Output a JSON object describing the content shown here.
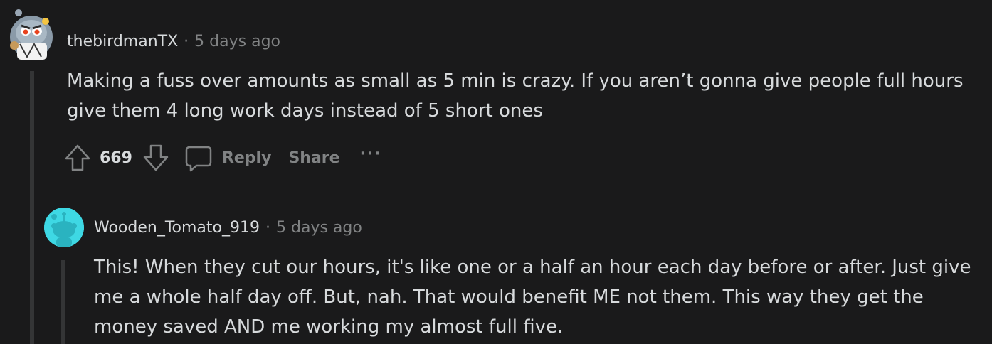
{
  "comments": [
    {
      "username": "thebirdmanTX",
      "separator": "·",
      "time": "5 days ago",
      "avatar_icon": "snoo-avatar-icon",
      "body_lines": [
        "Making a fuss over amounts as small as 5 min is crazy. If you aren’t gonna give people full hours",
        "give them 4 long work days instead of 5 short ones"
      ],
      "actions": {
        "upvote_icon": "upvote-arrow-icon",
        "votes": "669",
        "downvote_icon": "downvote-arrow-icon",
        "reply_icon": "comment-bubble-icon",
        "reply_label": "Reply",
        "share_label": "Share",
        "more_label": "···"
      }
    },
    {
      "username": "Wooden_Tomato_919",
      "separator": "·",
      "time": "5 days ago",
      "avatar_icon": "default-snoo-avatar-icon",
      "body_lines": [
        "This! When they cut our hours, it's like one or a half an hour each day before or after. Just give",
        "me a whole half day off. But, nah. That would benefit ME not them. This way they get the",
        "money saved AND me working my almost full five."
      ]
    }
  ],
  "colors": {
    "background": "#1a1a1b",
    "text": "#d7dadc",
    "muted": "#818384",
    "thread_line": "#343536",
    "avatar_teal": "#3ed8e4"
  }
}
